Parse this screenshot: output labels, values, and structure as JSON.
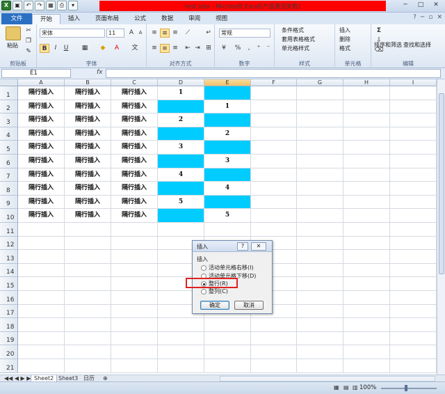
{
  "window": {
    "title": "test.xlsx - Microsoft Excel(产品激活失败)",
    "controls": [
      "─",
      "□",
      "✕"
    ]
  },
  "ribbon": {
    "tabs": [
      "文件",
      "开始",
      "插入",
      "页面布局",
      "公式",
      "数据",
      "审阅",
      "视图"
    ],
    "groups": {
      "clipboard": {
        "label": "剪贴板",
        "paste": "粘贴"
      },
      "font": {
        "label": "字体",
        "font_name": "宋体",
        "font_size": "11",
        "bold": "B",
        "italic": "I",
        "underline": "U"
      },
      "alignment": {
        "label": "对齐方式"
      },
      "number": {
        "label": "数字",
        "format": "常规"
      },
      "styles": {
        "label": "样式",
        "items": [
          "条件格式",
          "套用表格格式",
          "单元格样式"
        ]
      },
      "cells": {
        "label": "单元格",
        "items": [
          "插入",
          "删除",
          "格式"
        ]
      },
      "editing": {
        "label": "编辑",
        "sort": "排序和筛选",
        "find": "查找和选择",
        "sigma": "Σ"
      }
    }
  },
  "formula_bar": {
    "name_box": "E1",
    "fx": "fx",
    "value": ""
  },
  "grid": {
    "columns": [
      "A",
      "B",
      "C",
      "D",
      "E",
      "F",
      "G",
      "H",
      "I"
    ],
    "selected_column": "E",
    "rows": [
      "1",
      "2",
      "3",
      "4",
      "5",
      "6",
      "7",
      "8",
      "9",
      "10",
      "11",
      "12",
      "13",
      "14",
      "15",
      "16",
      "17",
      "18",
      "19",
      "20",
      "21"
    ],
    "text": "隔行插入",
    "d_values": [
      "1",
      "",
      "2",
      "",
      "3",
      "",
      "4",
      "",
      "5",
      ""
    ],
    "e_values": [
      "",
      "1",
      "",
      "2",
      "",
      "3",
      "",
      "4",
      "",
      "5"
    ],
    "fill_color": "#00ccff"
  },
  "sheets": {
    "tabs": [
      "Sheet2",
      "Sheet3",
      "日历"
    ],
    "active": "Sheet2"
  },
  "status": {
    "zoom": "100%"
  },
  "dialog": {
    "title": "插入",
    "help": "?",
    "close": "✕",
    "section": "插入",
    "options": [
      {
        "label": "活动单元格右移(I)",
        "selected": false
      },
      {
        "label": "活动单元格下移(D)",
        "selected": false
      },
      {
        "label": "整行(R)",
        "selected": true
      },
      {
        "label": "整列(C)",
        "selected": false
      }
    ],
    "ok": "确定",
    "cancel": "取消"
  },
  "annotation": {
    "color": "#e02020"
  }
}
